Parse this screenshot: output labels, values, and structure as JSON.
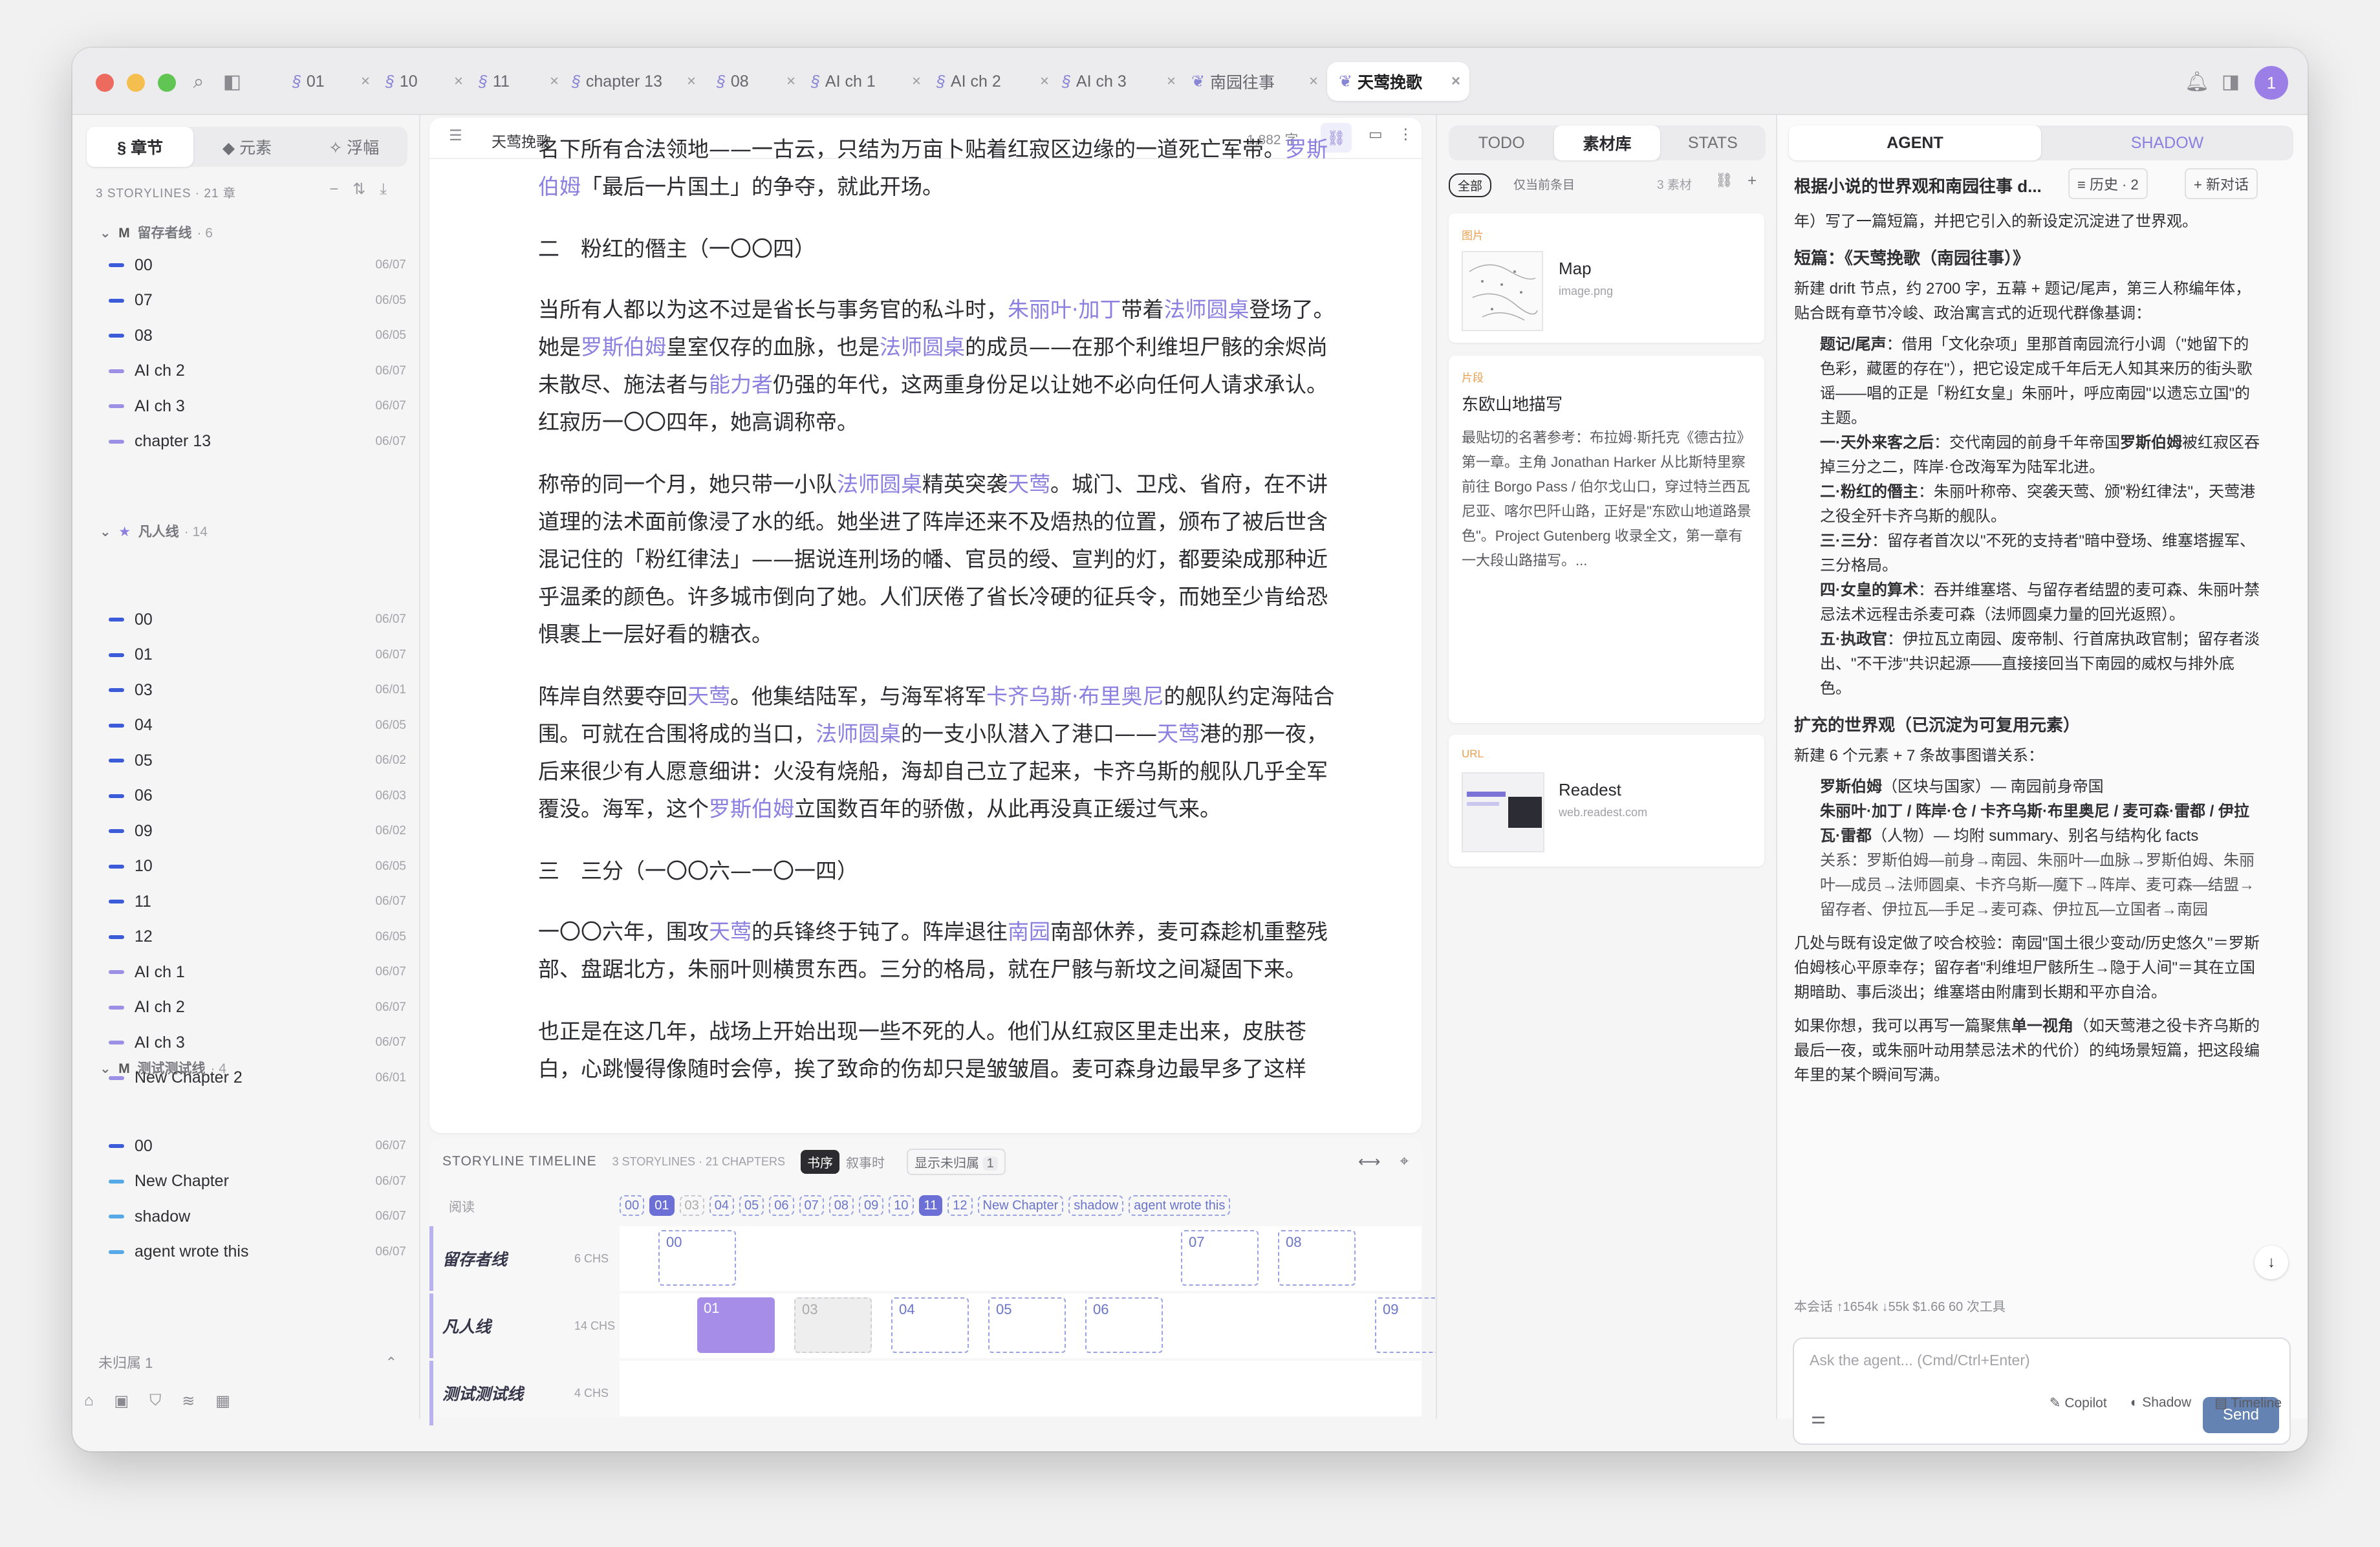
{
  "tabs": [
    {
      "sym": "§",
      "label": "01"
    },
    {
      "sym": "§",
      "label": "10"
    },
    {
      "sym": "§",
      "label": "11"
    },
    {
      "sym": "§",
      "label": "chapter 13"
    },
    {
      "sym": "§",
      "label": "08"
    },
    {
      "sym": "§",
      "label": "AI ch 1"
    },
    {
      "sym": "§",
      "label": "AI ch 2"
    },
    {
      "sym": "§",
      "label": "AI ch 3"
    },
    {
      "sym": "❦",
      "label": "南园往事"
    },
    {
      "sym": "❦",
      "label": "天莺挽歌"
    }
  ],
  "avatar": "1",
  "left": {
    "seg": [
      "§ 章节",
      "◆ 元素",
      "✧ 浮幅"
    ],
    "storylines_header": "3 STORYLINES · 21 章",
    "groups": [
      {
        "name": "留存者线",
        "count": "6",
        "items": [
          {
            "t": "00",
            "d": "06/07"
          },
          {
            "t": "07",
            "d": "06/05"
          },
          {
            "t": "08",
            "d": "06/05"
          },
          {
            "t": "AI ch 2",
            "d": "06/07"
          },
          {
            "t": "AI ch 3",
            "d": "06/07"
          },
          {
            "t": "chapter 13",
            "d": "06/07"
          }
        ]
      },
      {
        "name": "凡人线",
        "count": "14",
        "items": [
          {
            "t": "00",
            "d": "06/07"
          },
          {
            "t": "01",
            "d": "06/07"
          },
          {
            "t": "03",
            "d": "06/01"
          },
          {
            "t": "04",
            "d": "06/05"
          },
          {
            "t": "05",
            "d": "06/02"
          },
          {
            "t": "06",
            "d": "06/03"
          },
          {
            "t": "09",
            "d": "06/02"
          },
          {
            "t": "10",
            "d": "06/05"
          },
          {
            "t": "11",
            "d": "06/07"
          },
          {
            "t": "12",
            "d": "06/05"
          },
          {
            "t": "AI ch 1",
            "d": "06/07"
          },
          {
            "t": "AI ch 2",
            "d": "06/07"
          },
          {
            "t": "AI ch 3",
            "d": "06/07"
          },
          {
            "t": "New Chapter 2",
            "d": "06/01"
          }
        ]
      },
      {
        "name": "测试测试线",
        "count": "4",
        "items": [
          {
            "t": "00",
            "d": "06/07"
          },
          {
            "t": "New Chapter",
            "d": "06/07"
          },
          {
            "t": "shadow",
            "d": "06/07"
          },
          {
            "t": "agent wrote this",
            "d": "06/07"
          }
        ]
      }
    ],
    "unassigned": "未归属  1"
  },
  "editor": {
    "title": "天莺挽歌",
    "wordcount": "1,882 字"
  },
  "timeline": {
    "title": "STORYLINE TIMELINE",
    "meta": "3 STORYLINES · 21 CHAPTERS",
    "mode_on": "书序",
    "mode_off": "叙事时",
    "toggle": "显示未归属",
    "toggle_count": "1",
    "reading": "阅读",
    "chips": [
      "00",
      "01",
      "03",
      "04",
      "05",
      "06",
      "07",
      "08",
      "09",
      "10",
      "11",
      "12",
      "New Chapter",
      "shadow",
      "agent wrote this"
    ],
    "rows": [
      {
        "name": "留存者线",
        "count": "6 CHS"
      },
      {
        "name": "凡人线",
        "count": "14 CHS"
      },
      {
        "name": "测试测试线",
        "count": "4 CHS"
      }
    ],
    "blocks_row0": [
      "00",
      "07",
      "08"
    ],
    "blocks_row1": [
      "01",
      "03",
      "04",
      "05",
      "06",
      "09"
    ]
  },
  "mid": {
    "tabs": [
      "TODO",
      "素材库",
      "STATS"
    ],
    "filter_all": "全部",
    "filter_cur": "仅当前条目",
    "count": "3 素材",
    "cards": [
      {
        "kind": "图片",
        "title": "Map",
        "sub": "image.png"
      },
      {
        "kind": "片段",
        "title": "东欧山地描写",
        "body": "最贴切的名著参考：布拉姆·斯托克《德古拉》第一章。主角 Jonathan Harker 从比斯特里察前往 Borgo Pass / 伯尔戈山口，穿过特兰西瓦尼亚、喀尔巴阡山路，正好是\"东欧山地道路景色\"。Project Gutenberg 收录全文，第一章有一大段山路描写。..."
      },
      {
        "kind": "URL",
        "title": "Readest",
        "sub": "web.readest.com"
      }
    ]
  },
  "agent": {
    "tabs": [
      "AGENT",
      "SHADOW"
    ],
    "convo_title": "根据小说的世界观和南园往事 d...",
    "history": "≡ 历史 · 2",
    "new_chat": "+ 新对话",
    "stats": "本会话   ↑1654k ↓55k   $1.66   60 次工具",
    "input_placeholder": "Ask the agent... (Cmd/Ctrl+Enter)",
    "send": "Send"
  },
  "status_right": [
    "Copilot",
    "Shadow",
    "Timeline"
  ],
  "colors": {
    "accent": "#8b7fe0",
    "send": "#6483b3",
    "lightred": "#ed6a5e",
    "lightyellow": "#f5bf4f",
    "lightgreen": "#61c554"
  }
}
